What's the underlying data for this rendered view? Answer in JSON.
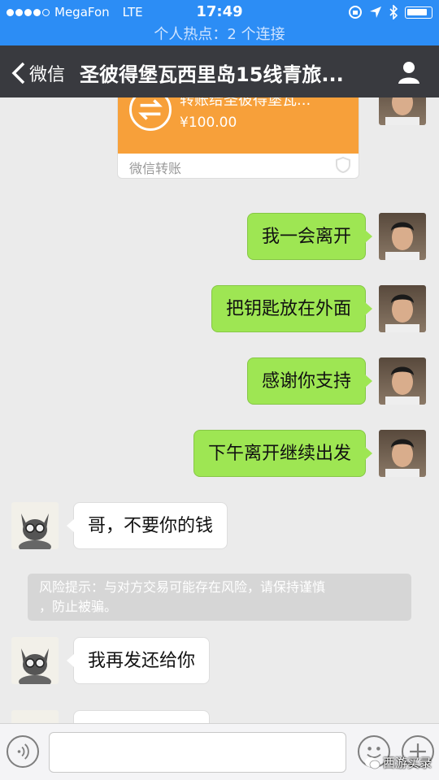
{
  "status_bar": {
    "carrier": "MegaFon",
    "network": "LTE",
    "time": "17:49"
  },
  "hotspot_text": "个人热点：2 个连接",
  "nav": {
    "back_label": "微信",
    "title": "圣彼得堡瓦西里岛15线青旅..."
  },
  "transfer_card": {
    "title": "转账给圣彼得堡瓦...",
    "amount": "¥100.00",
    "footer": "微信转账"
  },
  "messages": [
    {
      "side": "me",
      "text": "我一会离开"
    },
    {
      "side": "me",
      "text": "把钥匙放在外面"
    },
    {
      "side": "me",
      "text": "感谢你支持"
    },
    {
      "side": "me",
      "text": "下午离开继续出发"
    },
    {
      "side": "other",
      "text": "哥，不要你的钱"
    },
    {
      "side": "other",
      "text": "我再发还给你"
    }
  ],
  "risk_notice": {
    "line1": "风险提示：与对方交易可能存在风险，请保持谨慎",
    "line2": "，防止被骗。"
  },
  "watermark": "西游买录",
  "icons": {
    "back": "chevron-left-icon",
    "profile": "person-icon",
    "transfer": "transfer-arrows-icon",
    "voice": "voice-icon",
    "emoji": "emoji-icon",
    "plus": "plus-icon"
  },
  "colors": {
    "status_bar": "#2c8df5",
    "nav_bar": "#393a3f",
    "my_bubble": "#9ee653",
    "transfer_card": "#f7a03a",
    "chat_bg": "#ebebeb"
  }
}
